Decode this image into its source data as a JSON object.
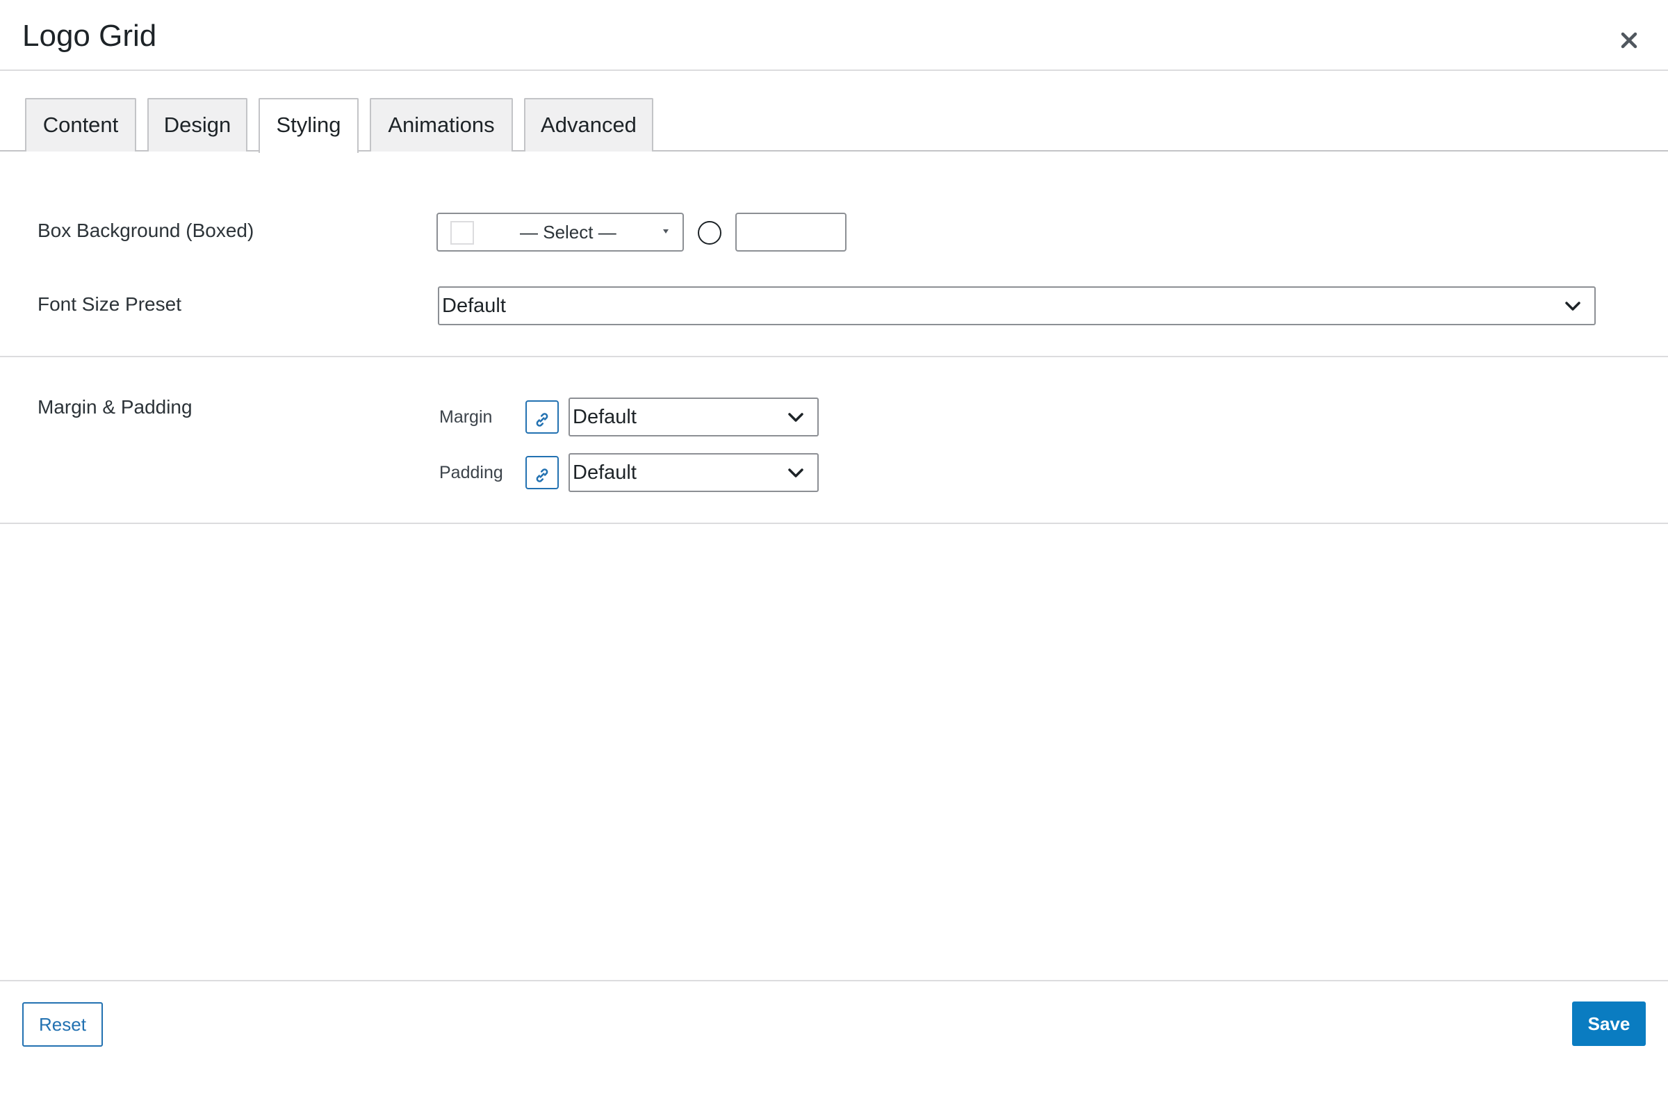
{
  "dialog": {
    "title": "Logo Grid",
    "close_icon": "close-icon"
  },
  "tabs": [
    {
      "label": "Content",
      "active": false
    },
    {
      "label": "Design",
      "active": false
    },
    {
      "label": "Styling",
      "active": true
    },
    {
      "label": "Animations",
      "active": false
    },
    {
      "label": "Advanced",
      "active": false
    }
  ],
  "styling": {
    "box_background": {
      "label": "Box Background (Boxed)",
      "select_label": "— Select —",
      "swatch_color": "#ffffff",
      "opacity_value": ""
    },
    "font_size_preset": {
      "label": "Font Size Preset",
      "value": "Default"
    },
    "margin_padding": {
      "label": "Margin & Padding",
      "margin_label": "Margin",
      "margin_value": "Default",
      "padding_label": "Padding",
      "padding_value": "Default",
      "link_icon": "link-icon"
    }
  },
  "footer": {
    "reset_label": "Reset",
    "save_label": "Save"
  },
  "colors": {
    "accent": "#2271b1",
    "save_button": "#0a7cc1",
    "border": "#dcdcde"
  }
}
